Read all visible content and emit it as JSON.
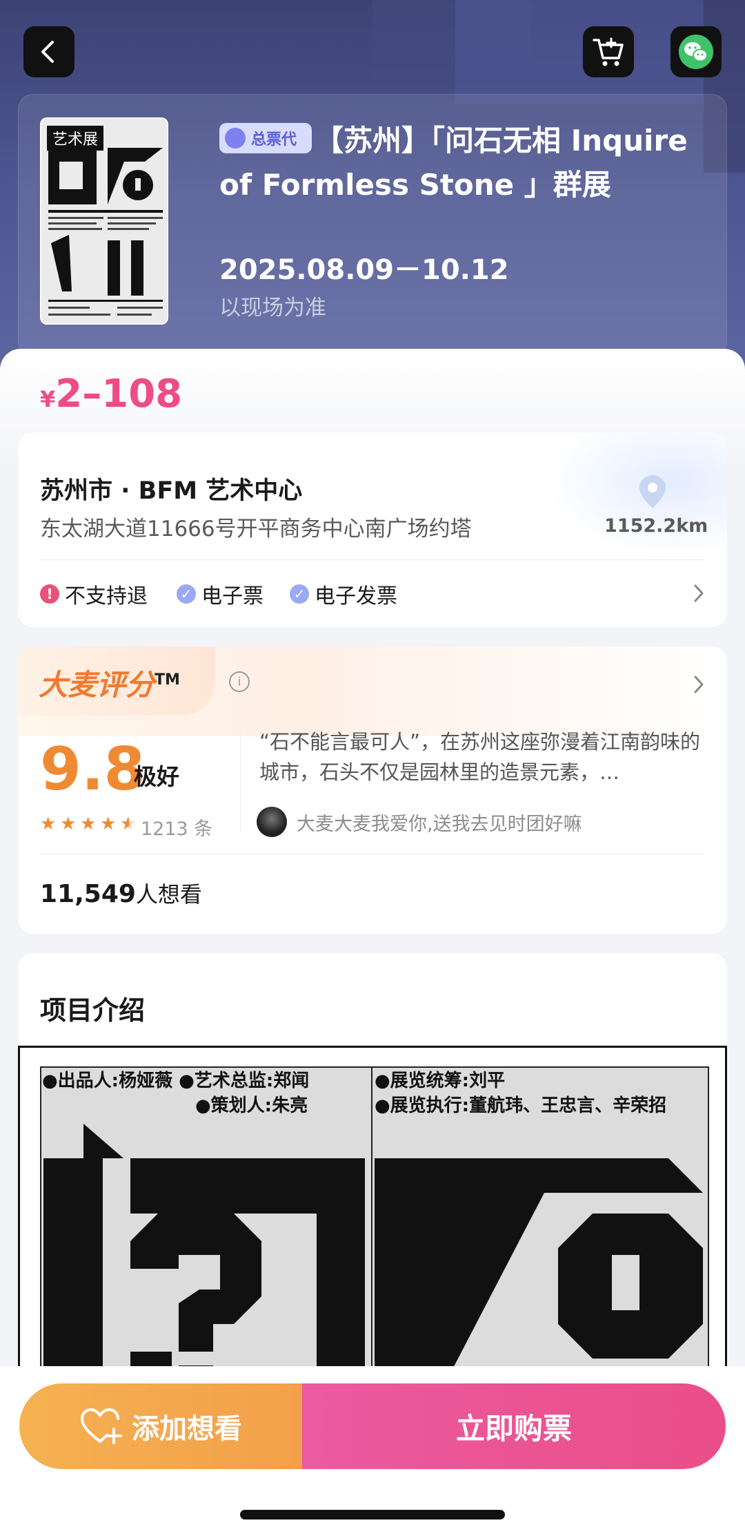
{
  "header": {
    "poster_tag": "艺术展",
    "badge": "总票代",
    "title": "【苏州】「问石无相 Inquire of Formless Stone 」群展",
    "date_range": "2025.08.09－10.12",
    "date_note": "以现场为准"
  },
  "price": {
    "currency": "¥",
    "range": "2–108"
  },
  "venue": {
    "name": "苏州市 · BFM 艺术中心",
    "address": "东太湖大道11666号开平商务中心南广场约塔",
    "distance": "1152.2km",
    "features": [
      {
        "label": "不支持退",
        "icon": "exclamation-icon",
        "color": "#e8527a"
      },
      {
        "label": "电子票",
        "icon": "check-icon",
        "color": "#9aa8f5"
      },
      {
        "label": "电子发票",
        "icon": "check-icon",
        "color": "#9aa8f5"
      }
    ]
  },
  "rating": {
    "brand": "大麦评分",
    "brand_tm": "TM",
    "score": "9.8",
    "score_word": "极好",
    "stars": 4.5,
    "review_count": "1213 条",
    "quote": "“石不能言最可人”，在苏州这座弥漫着江南韵味的城市，石头不仅是园林里的造景元素，…",
    "reviewer": "大麦大麦我爱你,送我去见时团好嘛",
    "wants_number": "11,549",
    "wants_label": "人想看"
  },
  "intro": {
    "title": "项目介绍",
    "credits_left": [
      "●出品人:杨娅薇 ●艺术总监:郑闻",
      "●策划人:朱亮"
    ],
    "credits_right": [
      "●展览统筹:刘平",
      "●展览执行:董航玮、王忠言、辛荣招"
    ]
  },
  "actions": {
    "want": "添加想看",
    "buy": "立即购票"
  },
  "colors": {
    "accent": "#ef4b86",
    "score": "#f08a32",
    "hero": "#4d5590"
  }
}
